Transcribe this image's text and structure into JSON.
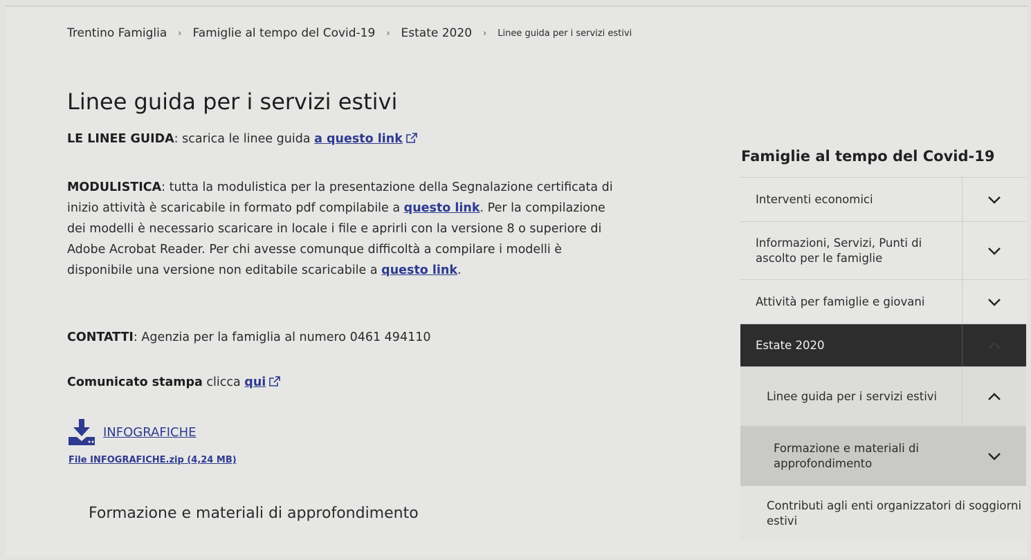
{
  "breadcrumb": {
    "items": [
      "Trentino Famiglia",
      "Famiglie al tempo del Covid-19",
      "Estate 2020"
    ],
    "current": "Linee guida per i servizi estivi",
    "separator": "›"
  },
  "main": {
    "title": "Linee guida per i servizi estivi",
    "linee_guida": {
      "label": "LE LINEE GUIDA",
      "text": ": scarica le linee guida ",
      "link": "a questo link"
    },
    "modulistica": {
      "label": "MODULISTICA",
      "text1": ": tutta la modulistica per la presentazione della Segnalazione certificata di inizio attività è scaricabile in formato pdf compilabile a ",
      "link1": "questo link",
      "text2": ". Per la compilazione dei modelli è necessario scaricare in locale i file e aprirli con la versione 8 o superiore di Adobe Acrobat Reader. Per chi avesse comunque difficoltà a compilare i modelli è disponibile una versione non editabile scaricabile a ",
      "link2": "questo link",
      "text3": "."
    },
    "contatti": {
      "label": "CONTATTI",
      "text": ": Agenzia per la famiglia al numero 0461 494110"
    },
    "comunicato": {
      "label": "Comunicato stampa",
      "text": " clicca ",
      "link": "qui"
    },
    "download": {
      "label": "INFOGRAFICHE",
      "file": "File INFOGRAFICHE.zip (4,24 MB)",
      "icon": "download-icon"
    },
    "section_title": "Formazione e materiali di approfondimento"
  },
  "sidebar": {
    "title": "Famiglie al tempo del Covid-19",
    "items": [
      {
        "label": "Interventi economici",
        "state": "collapsed"
      },
      {
        "label": "Informazioni, Servizi, Punti di ascolto per le famiglie",
        "state": "collapsed"
      },
      {
        "label": "Attività per famiglie e giovani",
        "state": "collapsed"
      },
      {
        "label": "Estate 2020",
        "state": "expanded-active"
      },
      {
        "label": "Linee guida per i servizi estivi",
        "state": "expanded"
      },
      {
        "label": "Formazione e materiali di approfondimento",
        "state": "collapsed"
      },
      {
        "label": "Contributi agli enti organizzatori di soggiorni estivi",
        "state": "none"
      }
    ]
  },
  "colors": {
    "link": "#2e3a8f",
    "active_bg": "#2d2d2d",
    "page_bg": "#e6e7e5"
  }
}
